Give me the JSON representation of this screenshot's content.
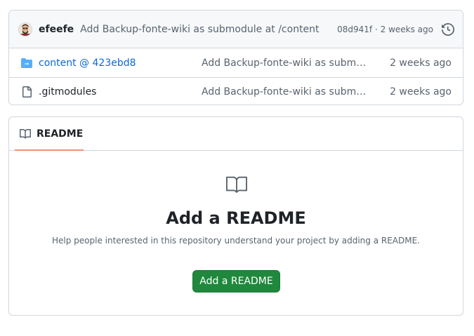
{
  "commit": {
    "author": "efeefe",
    "message": "Add Backup-fonte-wiki as submodule at /content",
    "hash": "08d941f",
    "separator": "·",
    "age": "2 weeks ago"
  },
  "files": [
    {
      "name": "content @ 423ebd8",
      "type": "submodule",
      "message": "Add Backup-fonte-wiki as submodule at /content",
      "age": "2 weeks ago"
    },
    {
      "name": ".gitmodules",
      "type": "file",
      "message": "Add Backup-fonte-wiki as submodule at /content",
      "age": "2 weeks ago"
    }
  ],
  "readme": {
    "tab_label": "README",
    "title": "Add a README",
    "description": "Help people interested in this repository understand your project by adding a README.",
    "button_label": "Add a README"
  },
  "colors": {
    "link": "#0969da",
    "primary_button": "#1f883d",
    "tab_underline": "#fd8c73",
    "folder_icon": "#54aeff",
    "muted_text": "#59636e"
  },
  "icons": {
    "history": "history-icon",
    "submodule": "file-submodule-icon",
    "file": "file-icon",
    "book": "book-icon"
  }
}
